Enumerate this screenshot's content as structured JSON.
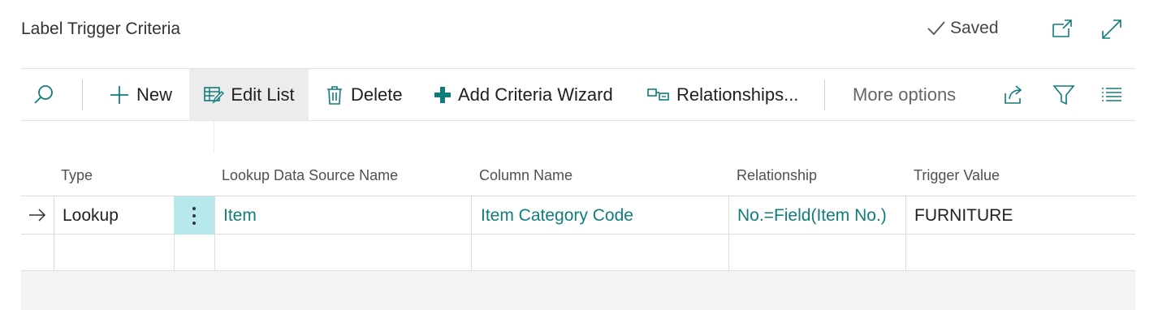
{
  "header": {
    "title": "Label Trigger Criteria",
    "saved_label": "Saved"
  },
  "toolbar": {
    "new_label": "New",
    "edit_list_label": "Edit List",
    "delete_label": "Delete",
    "add_criteria_wizard_label": "Add Criteria Wizard",
    "relationships_label": "Relationships...",
    "more_options_label": "More options"
  },
  "table": {
    "columns": [
      "Type",
      "Lookup Data Source Name",
      "Column Name",
      "Relationship",
      "Trigger Value"
    ],
    "rows": [
      {
        "type": "Lookup",
        "lookup_data_source_name": "Item",
        "column_name": "Item Category Code",
        "relationship": "No.=Field(Item No.)",
        "trigger_value": "FURNITURE"
      }
    ]
  },
  "colors": {
    "accent": "#0f7d7a",
    "selected_cell": "#b7e8ec",
    "active_button": "#ececec"
  }
}
